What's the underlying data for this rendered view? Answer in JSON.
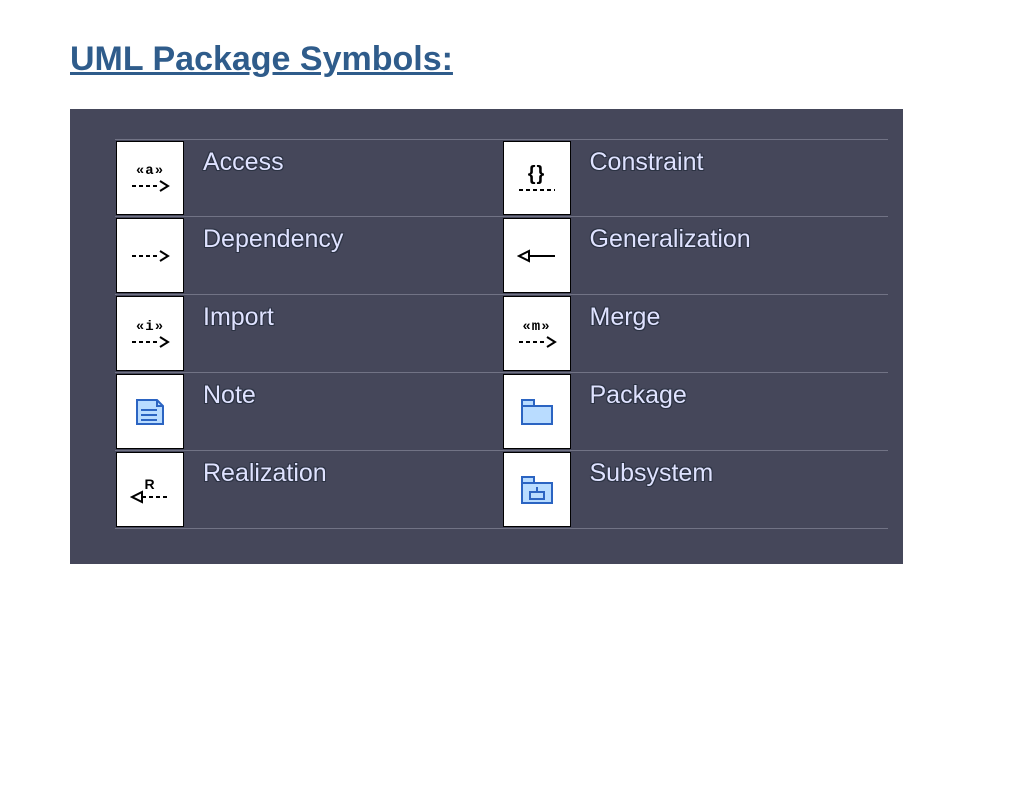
{
  "title": "UML Package Symbols:",
  "left_items": [
    {
      "name": "access",
      "label": "Access",
      "stereo": "«a»",
      "icon": "dashed-arrow"
    },
    {
      "name": "dependency",
      "label": "Dependency",
      "stereo": "",
      "icon": "dashed-arrow"
    },
    {
      "name": "import",
      "label": "Import",
      "stereo": "«i»",
      "icon": "dashed-arrow"
    },
    {
      "name": "note",
      "label": "Note",
      "stereo": "",
      "icon": "note"
    },
    {
      "name": "realization",
      "label": "Realization",
      "stereo": "R",
      "icon": "realization"
    }
  ],
  "right_items": [
    {
      "name": "constraint",
      "label": "Constraint",
      "stereo": "{}",
      "icon": "constraint"
    },
    {
      "name": "generalization",
      "label": "Generalization",
      "stereo": "",
      "icon": "generalization"
    },
    {
      "name": "merge",
      "label": "Merge",
      "stereo": "«m»",
      "icon": "dashed-arrow"
    },
    {
      "name": "package",
      "label": "Package",
      "stereo": "",
      "icon": "package"
    },
    {
      "name": "subsystem",
      "label": "Subsystem",
      "stereo": "",
      "icon": "subsystem"
    }
  ]
}
